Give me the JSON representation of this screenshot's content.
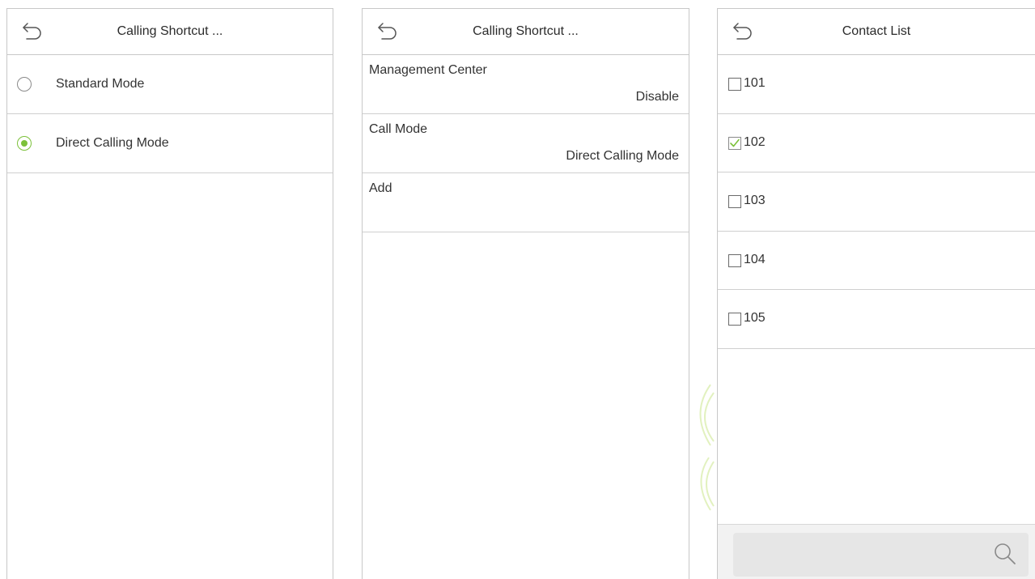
{
  "panel1": {
    "title": "Calling Shortcut ...",
    "options": [
      {
        "label": "Standard Mode",
        "selected": false
      },
      {
        "label": "Direct Calling Mode",
        "selected": true
      }
    ]
  },
  "panel2": {
    "title": "Calling Shortcut ...",
    "rows": [
      {
        "label": "Management Center",
        "value": "Disable"
      },
      {
        "label": "Call Mode",
        "value": "Direct Calling Mode"
      },
      {
        "label": "Add",
        "value": ""
      }
    ]
  },
  "panel3": {
    "title": "Contact List",
    "contacts": [
      {
        "label": "101",
        "checked": false
      },
      {
        "label": "102",
        "checked": true
      },
      {
        "label": "103",
        "checked": false
      },
      {
        "label": "104",
        "checked": false
      },
      {
        "label": "105",
        "checked": false
      }
    ],
    "search": {
      "placeholder": "",
      "value": ""
    }
  },
  "colors": {
    "accent": "#7cc13a",
    "divider": "#cfcfcf",
    "search_bg": "#e6e6e6"
  },
  "icons": {
    "back": "back-arrow-icon",
    "search": "search-icon",
    "check": "checkmark-icon"
  }
}
